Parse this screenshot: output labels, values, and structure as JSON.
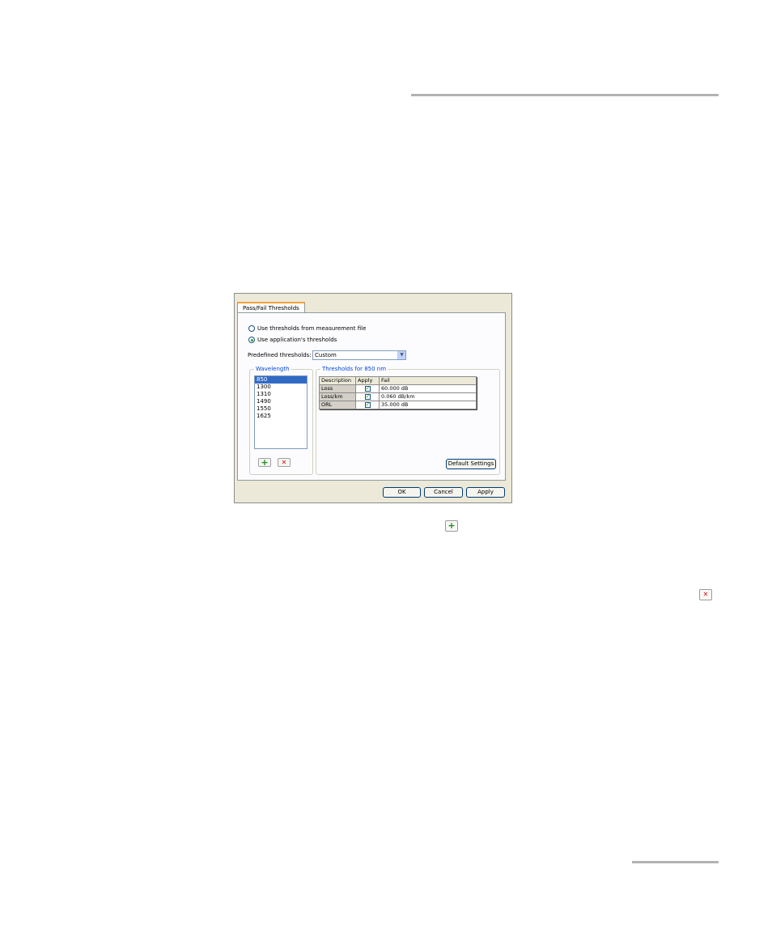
{
  "dialog": {
    "tab_label": "Pass/Fail Thresholds",
    "radio_measurement_file": "Use thresholds from measurement file",
    "radio_application": "Use application's thresholds",
    "predefined_label": "Predefined thresholds:",
    "predefined_value": "Custom",
    "wavelength_group_title": "Wavelength",
    "wavelengths": [
      "850",
      "1300",
      "1310",
      "1490",
      "1550",
      "1625"
    ],
    "selected_wavelength": "850",
    "thresholds_group_title": "Thresholds for 850 nm",
    "table": {
      "headers": [
        "Description",
        "Apply",
        "Fail"
      ],
      "rows": [
        {
          "description": "Loss",
          "apply": true,
          "fail": "60.000 dB"
        },
        {
          "description": "Loss/km",
          "apply": true,
          "fail": "0.060 dB/km"
        },
        {
          "description": "ORL",
          "apply": true,
          "fail": "35.000 dB"
        }
      ]
    },
    "default_settings_label": "Default Settings",
    "ok_label": "OK",
    "cancel_label": "Cancel",
    "apply_label": "Apply"
  },
  "icons": {
    "add": "plus-icon",
    "delete": "x-icon"
  },
  "colors": {
    "tab_accent": "#f2a33a",
    "group_title": "#0046d5",
    "selection": "#316ac5",
    "add_green": "#1e8a1e",
    "delete_red": "#d01010"
  }
}
